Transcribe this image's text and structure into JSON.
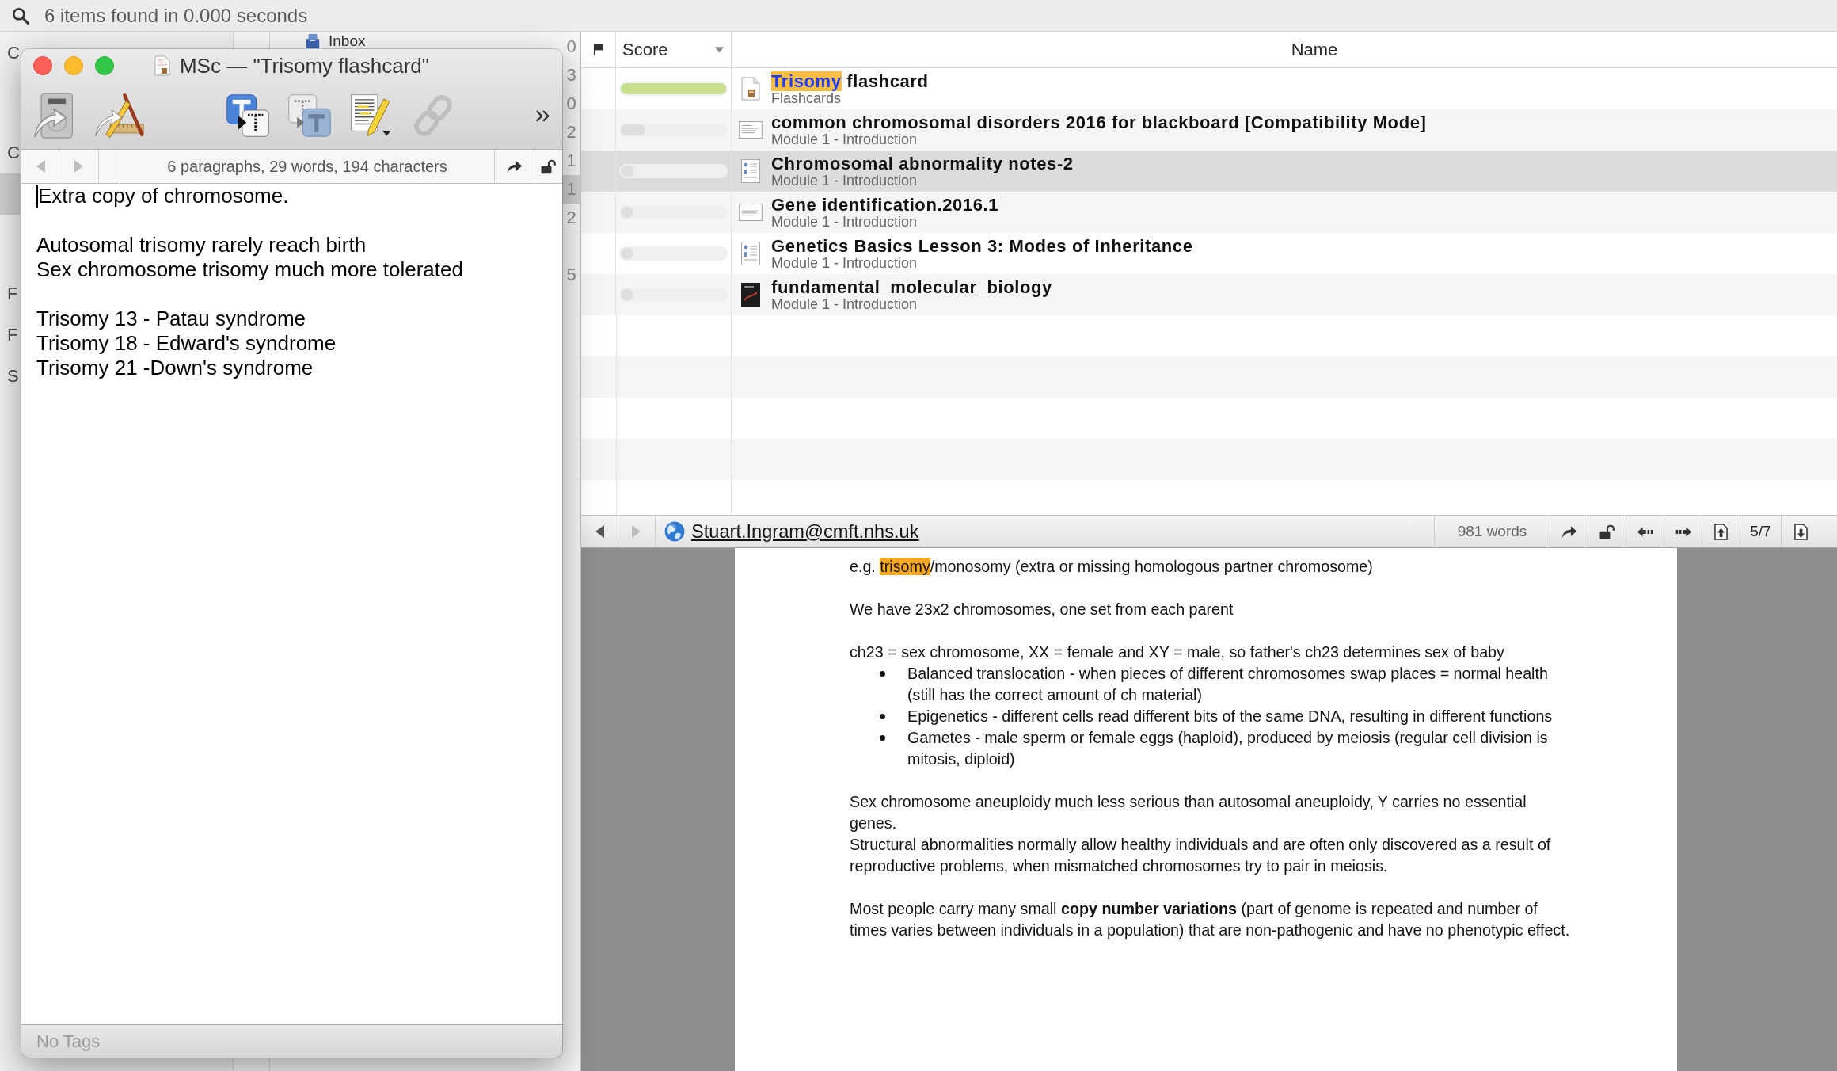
{
  "search_bar": {
    "status": "6 items found in 0.000 seconds"
  },
  "sidebar": {
    "sections": [
      {
        "items": [
          {
            "label": "C",
            "selected": false
          }
        ]
      },
      {
        "items": [
          {
            "label": "C",
            "selected": false
          },
          {
            "selected": true
          }
        ]
      },
      {
        "items": [
          {
            "label": "F",
            "selected": false
          },
          {
            "label": "F",
            "selected": false
          },
          {
            "label": "S",
            "selected": false
          }
        ]
      }
    ]
  },
  "group_list": {
    "rows": [
      {
        "label": "Inbox",
        "count": "0",
        "selected": false
      },
      {
        "count": "3",
        "selected": false
      },
      {
        "count": "0",
        "selected": false
      },
      {
        "count": "2",
        "selected": false
      },
      {
        "count": "1",
        "selected": false
      },
      {
        "count": "1",
        "selected": true
      },
      {
        "count": "2",
        "selected": false
      },
      {
        "selected": false
      },
      {
        "count": "5",
        "selected": false
      }
    ]
  },
  "note_window": {
    "title": "MSc — \"Trisomy flashcard\"",
    "toolbar": [
      {
        "disabled": false
      },
      {
        "disabled": false
      },
      {
        "disabled": false
      },
      {
        "disabled": false
      },
      {
        "disabled": false
      },
      {
        "disabled": true
      }
    ],
    "nav": [
      {
        "disabled": true
      },
      {
        "disabled": true
      }
    ],
    "stats": "6 paragraphs, 29 words, 194 characters",
    "paragraphs": [
      [
        "Extra copy of chromosome."
      ],
      [
        "Autosomal trisomy rarely reach birth",
        "Sex chromosome trisomy much more tolerated"
      ],
      [
        "Trisomy 13 - Patau syndrome",
        "Trisomy 18 - Edward's syndrome",
        "Trisomy 21 -Down's syndrome"
      ]
    ],
    "tags_field": {
      "placeholder": "No Tags"
    }
  },
  "results": {
    "columns": [
      {
        "label": "Score",
        "sorted": true
      },
      {
        "label": "Name",
        "sorted": false
      }
    ],
    "rows": [
      {
        "kind": "note",
        "title_runs": [
          {
            "text": "Trisomy",
            "match": true
          },
          {
            "text": " flashcard",
            "match": false
          }
        ],
        "location": "Flashcards",
        "level": 1.0,
        "selected": false
      },
      {
        "kind": "slides",
        "title_runs": [
          {
            "text": "common chromosomal disorders 2016 for blackboard [Compatibility Mode]",
            "match": false
          }
        ],
        "location": "Module 1 - Introduction",
        "level": 0.23,
        "selected": false
      },
      {
        "kind": "pages",
        "title_runs": [
          {
            "text": "Chromosomal abnormality notes-2",
            "match": false
          }
        ],
        "location": "Module 1 - Introduction",
        "level": 0.13,
        "selected": true
      },
      {
        "kind": "slides",
        "title_runs": [
          {
            "text": "Gene identification.2016.1",
            "match": false
          }
        ],
        "location": "Module 1 - Introduction",
        "level": 0.12,
        "selected": false
      },
      {
        "kind": "pages",
        "title_runs": [
          {
            "text": "Genetics Basics Lesson 3: Modes of Inheritance",
            "match": false
          }
        ],
        "location": "Module 1 - Introduction",
        "level": 0.12,
        "selected": false
      },
      {
        "kind": "cover",
        "title_runs": [
          {
            "text": "fundamental_molecular_biology",
            "match": false
          }
        ],
        "location": "Module 1 - Introduction",
        "level": 0.12,
        "selected": false
      }
    ]
  },
  "viewer_bar": {
    "nav": [
      {
        "disabled": false
      },
      {
        "disabled": true
      }
    ],
    "link": "Stuart.Ingram@cmft.nhs.uk",
    "word_count": "981 words",
    "page": "5/7"
  },
  "document": {
    "sections": [
      [
        {
          "kind": "paragraph",
          "runs": [
            {
              "text": "e.g. ",
              "match": false
            },
            {
              "text": "trisomy",
              "match": true
            },
            {
              "text": "/monosomy (extra or missing homologous partner chromosome)",
              "match": false
            }
          ]
        }
      ],
      [
        {
          "kind": "paragraph",
          "runs": [
            {
              "text": "We have 23x2 chromosomes, one set from each parent",
              "match": false
            }
          ]
        }
      ],
      [
        {
          "kind": "paragraph",
          "runs": [
            {
              "text": "ch23 = sex chromosome, XX = female and XY = male, so father's ch23 determines sex of baby",
              "match": false
            }
          ]
        },
        {
          "kind": "bullets",
          "items": [
            "Balanced translocation - when pieces of different chromosomes swap places = normal health (still has the correct amount of ch material)",
            "Epigenetics - different cells read different bits of the same DNA, resulting in different functions",
            "Gametes - male sperm or female eggs (haploid), produced by meiosis (regular cell division is mitosis, diploid)"
          ]
        }
      ],
      [
        {
          "kind": "paragraph",
          "runs": [
            {
              "text": "Sex chromosome aneuploidy much less serious than autosomal aneuploidy, Y carries no essential genes.",
              "match": false
            }
          ]
        },
        {
          "kind": "paragraph",
          "runs": [
            {
              "text": "Structural abnormalities normally allow healthy individuals and are often only discovered as a result of reproductive problems, when mismatched chromosomes try to pair in meiosis.",
              "match": false
            }
          ]
        }
      ],
      [
        {
          "kind": "paragraph",
          "runs": [
            {
              "text": "Most people carry many small **copy number variations** (part of genome is repeated and number of times varies between individuals in a population) that are non-pathogenic and have no phenotypic effect.",
              "match": false
            }
          ]
        }
      ]
    ]
  }
}
